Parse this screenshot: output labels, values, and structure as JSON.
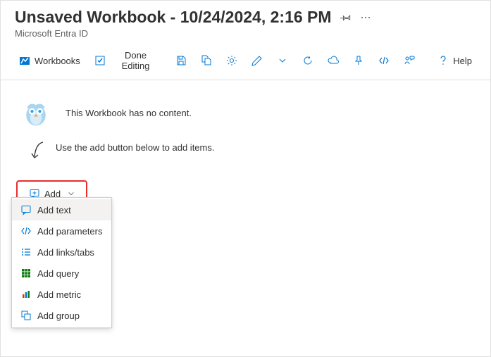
{
  "header": {
    "title": "Unsaved Workbook - 10/24/2024, 2:16 PM",
    "subtitle": "Microsoft Entra ID"
  },
  "toolbar": {
    "workbooks": "Workbooks",
    "done_editing": "Done Editing",
    "help": "Help"
  },
  "empty": {
    "headline": "This Workbook has no content.",
    "hint": "Use the add button below to add items."
  },
  "add_button": {
    "label": "Add"
  },
  "add_menu": {
    "items": [
      {
        "label": "Add text"
      },
      {
        "label": "Add parameters"
      },
      {
        "label": "Add links/tabs"
      },
      {
        "label": "Add query"
      },
      {
        "label": "Add metric"
      },
      {
        "label": "Add group"
      }
    ]
  }
}
